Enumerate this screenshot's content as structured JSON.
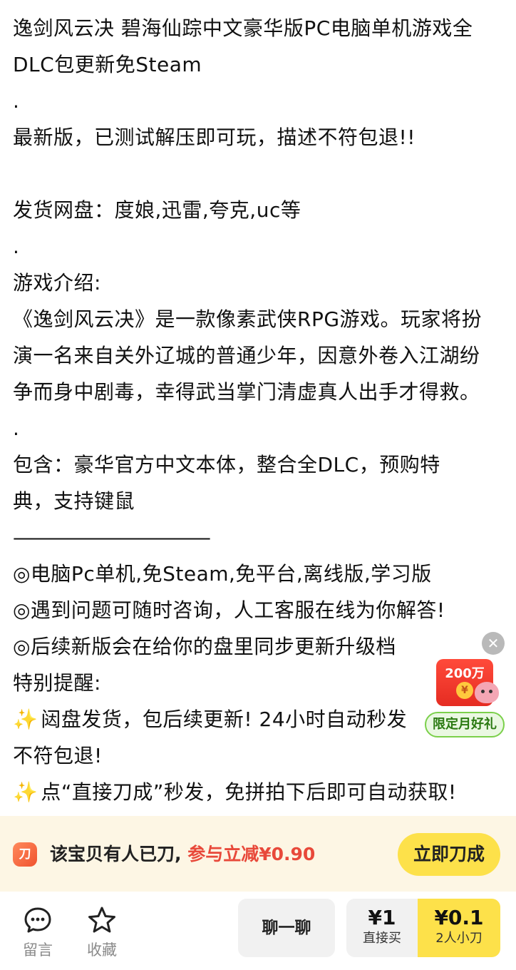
{
  "description": {
    "lines": [
      "逸剑风云决 碧海仙踪中文豪华版PC电脑单机游戏全",
      "DLC包更新免Steam",
      ".",
      "最新版，已测试解压即可玩，描述不符包退!!",
      "",
      "发货网盘：度娘,迅雷,夸克,uc等",
      ".",
      "游戏介绍:",
      "《逸剑风云决》是一款像素武侠RPG游戏。玩家将扮",
      "演一名来自关外辽城的普通少年，因意外卷入江湖纷",
      "争而身中剧毒，幸得武当掌门清虚真人出手才得救。",
      ".",
      "包含：豪华官方中文本体，整合全DLC，预购特",
      "典，支持键鼠",
      "———————————",
      "◎电脑Pc单机,免Steam,免平台,离线版,学习版",
      "◎遇到问题可随时咨询，人工客服在线为你解答!",
      "◎后续新版会在给你的盘里同步更新升级档",
      "特别提醒:",
      "闼盘发货，包后续更新! 24小时自动秒发",
      "不符包退!",
      "点“直接刀成”秒发，免拼拍下后即可自动获取!"
    ],
    "spark_glyph": "✨"
  },
  "promo": {
    "close_glyph": "✕",
    "amount": "200万",
    "coin_glyph": "¥",
    "label": "限定月好礼"
  },
  "banner": {
    "icon_glyph": "刀",
    "text_main": "该宝贝有人已刀,",
    "text_accent": "参与立减¥0.90",
    "button": "立即刀成"
  },
  "bottombar": {
    "comment_label": "留言",
    "favorite_label": "收藏",
    "chat_button": "聊一聊",
    "buy_price": "¥1",
    "buy_label": "直接买",
    "bargain_price": "¥0.1",
    "bargain_label": "2人小刀"
  }
}
